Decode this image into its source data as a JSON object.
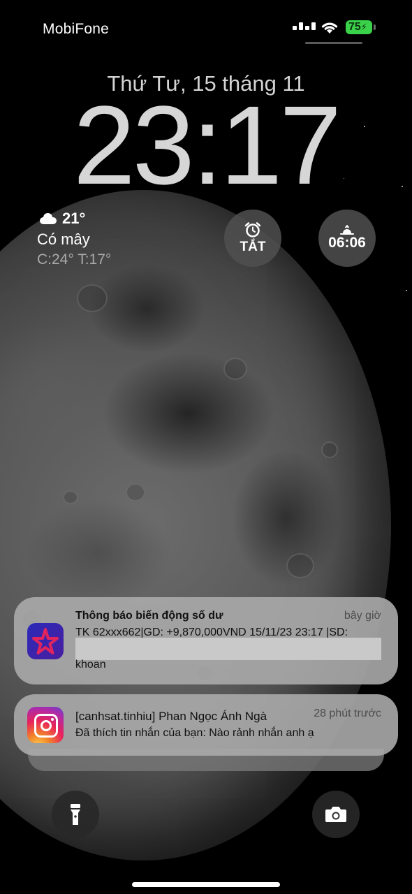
{
  "status_bar": {
    "carrier": "MobiFone",
    "battery": "75",
    "battery_color": "#3ad24a"
  },
  "lock_screen": {
    "date": "Thứ Tư, 15 tháng 11",
    "time": "23:17"
  },
  "weather": {
    "icon": "cloud-icon",
    "temperature": "21°",
    "condition": "Có mây",
    "high_low": "C:24° T:17°"
  },
  "widgets": {
    "alarm": {
      "icon": "alarm-clock-icon",
      "label": "TẮT"
    },
    "sunrise": {
      "icon": "sunrise-icon",
      "label": "06:06"
    }
  },
  "notifications": [
    {
      "app_icon": "banking-app-icon",
      "title": "Thông báo biến động số dư",
      "time": "bây giờ",
      "body": "TK 62xxx662|GD: +9,870,000VND 15/11/23 23:17 |SD:",
      "body_cont": "khoan"
    },
    {
      "app_icon": "instagram-icon",
      "title": "[canhsat.tinhiu] Phan Ngọc Ánh Ngà",
      "time": "28 phút trước",
      "body": "Đã thích tin nhắn của bạn: Nào rảnh nhắn anh ạ"
    }
  ],
  "quick_actions": {
    "flashlight": "flashlight-icon",
    "camera": "camera-icon"
  }
}
